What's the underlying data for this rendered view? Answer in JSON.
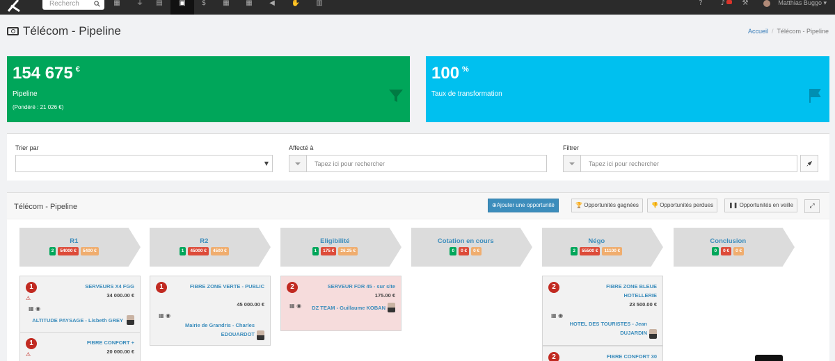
{
  "topnav": {
    "search_placeholder": "Recherch",
    "user_name": "Matthias Buggo"
  },
  "header": {
    "title": "Télécom - Pipeline",
    "breadcrumb": {
      "home": "Accueil",
      "current": "Télécom - Pipeline"
    }
  },
  "kpis": [
    {
      "value": "154 675",
      "unit": "€",
      "label": "Pipeline",
      "sub": "(Pondéré : 21 026 €)"
    },
    {
      "value": "100",
      "unit": "%",
      "label": "Taux de transformation",
      "sub": ""
    }
  ],
  "filters": {
    "sort_label": "Trier par",
    "assigned_label": "Affecté à",
    "assigned_placeholder": "Tapez ici pour rechercher",
    "filter_label": "Filtrer",
    "filter_placeholder": "Tapez ici pour rechercher"
  },
  "panel": {
    "title": "Télécom - Pipeline",
    "buttons": {
      "add": "Ajouter une opportunité",
      "won": "Opportunités gagnées",
      "lost": "Opportunités perdues",
      "watch": "Opportunités en veille"
    }
  },
  "stages": [
    {
      "name": "R1",
      "count": "2",
      "amount": "54000 €",
      "weighted": "5400 €"
    },
    {
      "name": "R2",
      "count": "1",
      "amount": "45000 €",
      "weighted": "4500 €"
    },
    {
      "name": "Eligibilité",
      "count": "1",
      "amount": "175 €",
      "weighted": "26.25 €"
    },
    {
      "name": "Cotation en cours",
      "count": "0",
      "amount": "0 €",
      "weighted": "0 €"
    },
    {
      "name": "Négo",
      "count": "2",
      "amount": "55500 €",
      "weighted": "11100 €"
    },
    {
      "name": "Conclusion",
      "count": "0",
      "amount": "0 €",
      "weighted": "0 €"
    }
  ],
  "cards": {
    "r1_1": {
      "num": "1",
      "title": "SERVEURS X4 FGG",
      "amount": "34 000.00 €",
      "client": "ALTITUDE PAYSAGE - Lisbeth GREY"
    },
    "r1_2": {
      "num": "1",
      "title": "FIBRE CONFORT +",
      "amount": "20 000.00 €"
    },
    "r2_1": {
      "num": "1",
      "title": "FIBRE ZONE VERTE - PUBLIC",
      "amount": "45 000.00 €",
      "client": "Mairie de Grandris - Charles EDOUARDOT"
    },
    "elig_1": {
      "num": "2",
      "title": "SERVEUR FDR 45 - sur site",
      "amount": "175.00 €",
      "client": "DZ TEAM - Guillaume KOBAN"
    },
    "nego_1": {
      "num": "2",
      "title": "FIBRE ZONE BLEUE HOTELLERIE",
      "amount": "23 500.00 €",
      "client": "HOTEL DES TOURISTES - Jean DUJARDIN"
    },
    "nego_2": {
      "num": "2",
      "title": "FIBRE CONFORT 30"
    }
  }
}
